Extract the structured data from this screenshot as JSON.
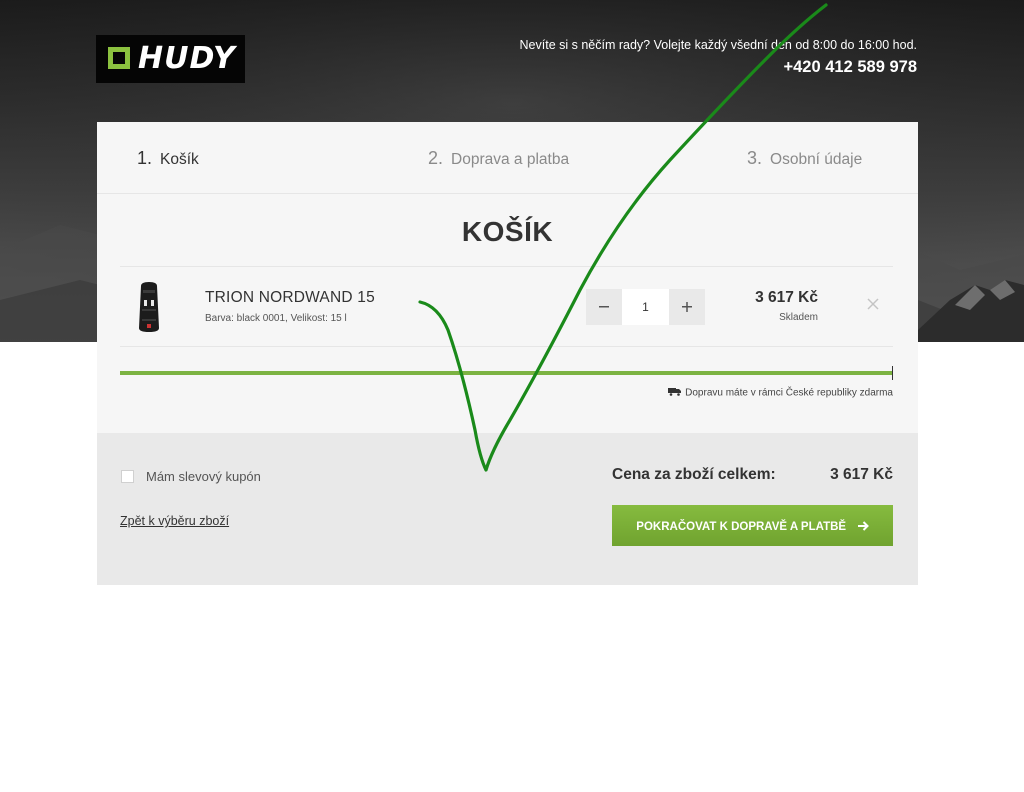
{
  "header": {
    "logo_text": "HUDY",
    "help_text": "Nevíte si s něčím rady? Volejte každý všední den od 8:00 do 16:00 hod.",
    "phone": "+420 412 589 978"
  },
  "steps": [
    {
      "number": "1.",
      "label": "Košík",
      "active": true
    },
    {
      "number": "2.",
      "label": "Doprava a platba",
      "active": false
    },
    {
      "number": "3.",
      "label": "Osobní údaje",
      "active": false
    }
  ],
  "page_title": "KOŠÍK",
  "cart_item": {
    "name": "TRION NORDWAND 15",
    "attributes": "Barva: black 0001, Velikost: 15 l",
    "quantity": "1",
    "price": "3 617 Kč",
    "stock": "Skladem",
    "icons": {
      "minus": "minus-icon",
      "plus": "plus-icon",
      "remove": "close-icon",
      "thumb": "backpack-image"
    }
  },
  "free_shipping": {
    "progress": 1.0,
    "note": "Dopravu máte v rámci České republiky zdarma",
    "icon": "truck-icon"
  },
  "summary": {
    "coupon_label": "Mám slevový kupón",
    "coupon_checked": false,
    "back_link": "Zpět k výběru zboží",
    "total_label": "Cena za zboží celkem:",
    "total_value": "3 617 Kč",
    "cta_label": "POKRAČOVAT K DOPRAVĚ A PLATBĚ",
    "cta_icon": "arrow-right-icon"
  },
  "colors": {
    "accent": "#7cb342",
    "logo_square": "#8bc13f",
    "annotation_stroke": "#1a8a1a",
    "card_bg": "#f6f6f6",
    "summary_bg": "#e9e9e9"
  }
}
